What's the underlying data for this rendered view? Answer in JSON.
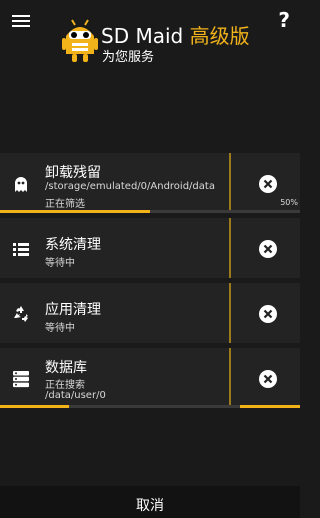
{
  "header": {
    "app_name": "SD Maid ",
    "app_edition": "高级版",
    "subtitle": "为您服务",
    "menu_icon": "hamburger-menu-icon",
    "help_label": "?"
  },
  "tasks": [
    {
      "name": "卸载残留",
      "path": "/storage/emulated/0/Android/data",
      "status": "正在筛选",
      "icon": "ghost-icon",
      "progress": 0.5,
      "progress_label": "50%"
    },
    {
      "name": "系统清理",
      "status": "等待中",
      "icon": "list-icon"
    },
    {
      "name": "应用清理",
      "status": "等待中",
      "icon": "recycle-icon"
    },
    {
      "name": "数据库",
      "status": "正在搜索",
      "path": "/data/user/0",
      "icon": "database-icon",
      "progress_segments": [
        0.23,
        0.2
      ]
    }
  ],
  "footer": {
    "cancel_label": "取消"
  },
  "colors": {
    "accent": "#f2b21a",
    "background": "#1a1a1a",
    "card": "#232323"
  }
}
